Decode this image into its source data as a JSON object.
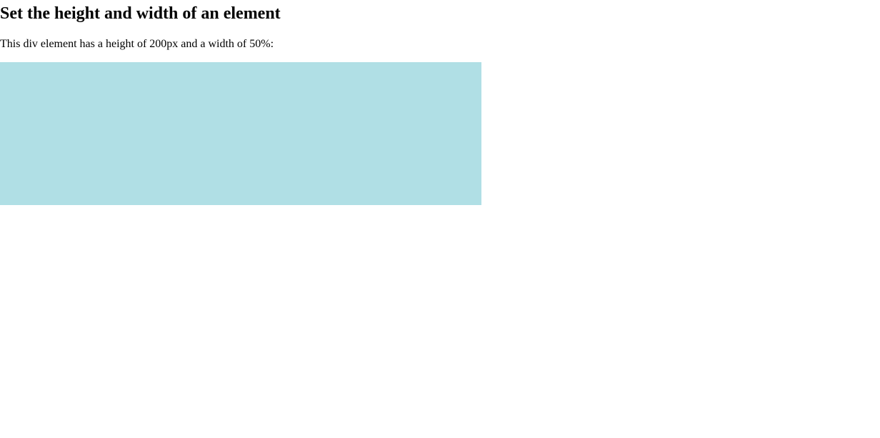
{
  "page": {
    "heading": "Set the height and width of an element",
    "description": "This div element has a height of 200px and a width of 50%:"
  },
  "colors": {
    "box_background": "#b0dfe5",
    "page_background": "#ffffff",
    "text": "#000000"
  }
}
